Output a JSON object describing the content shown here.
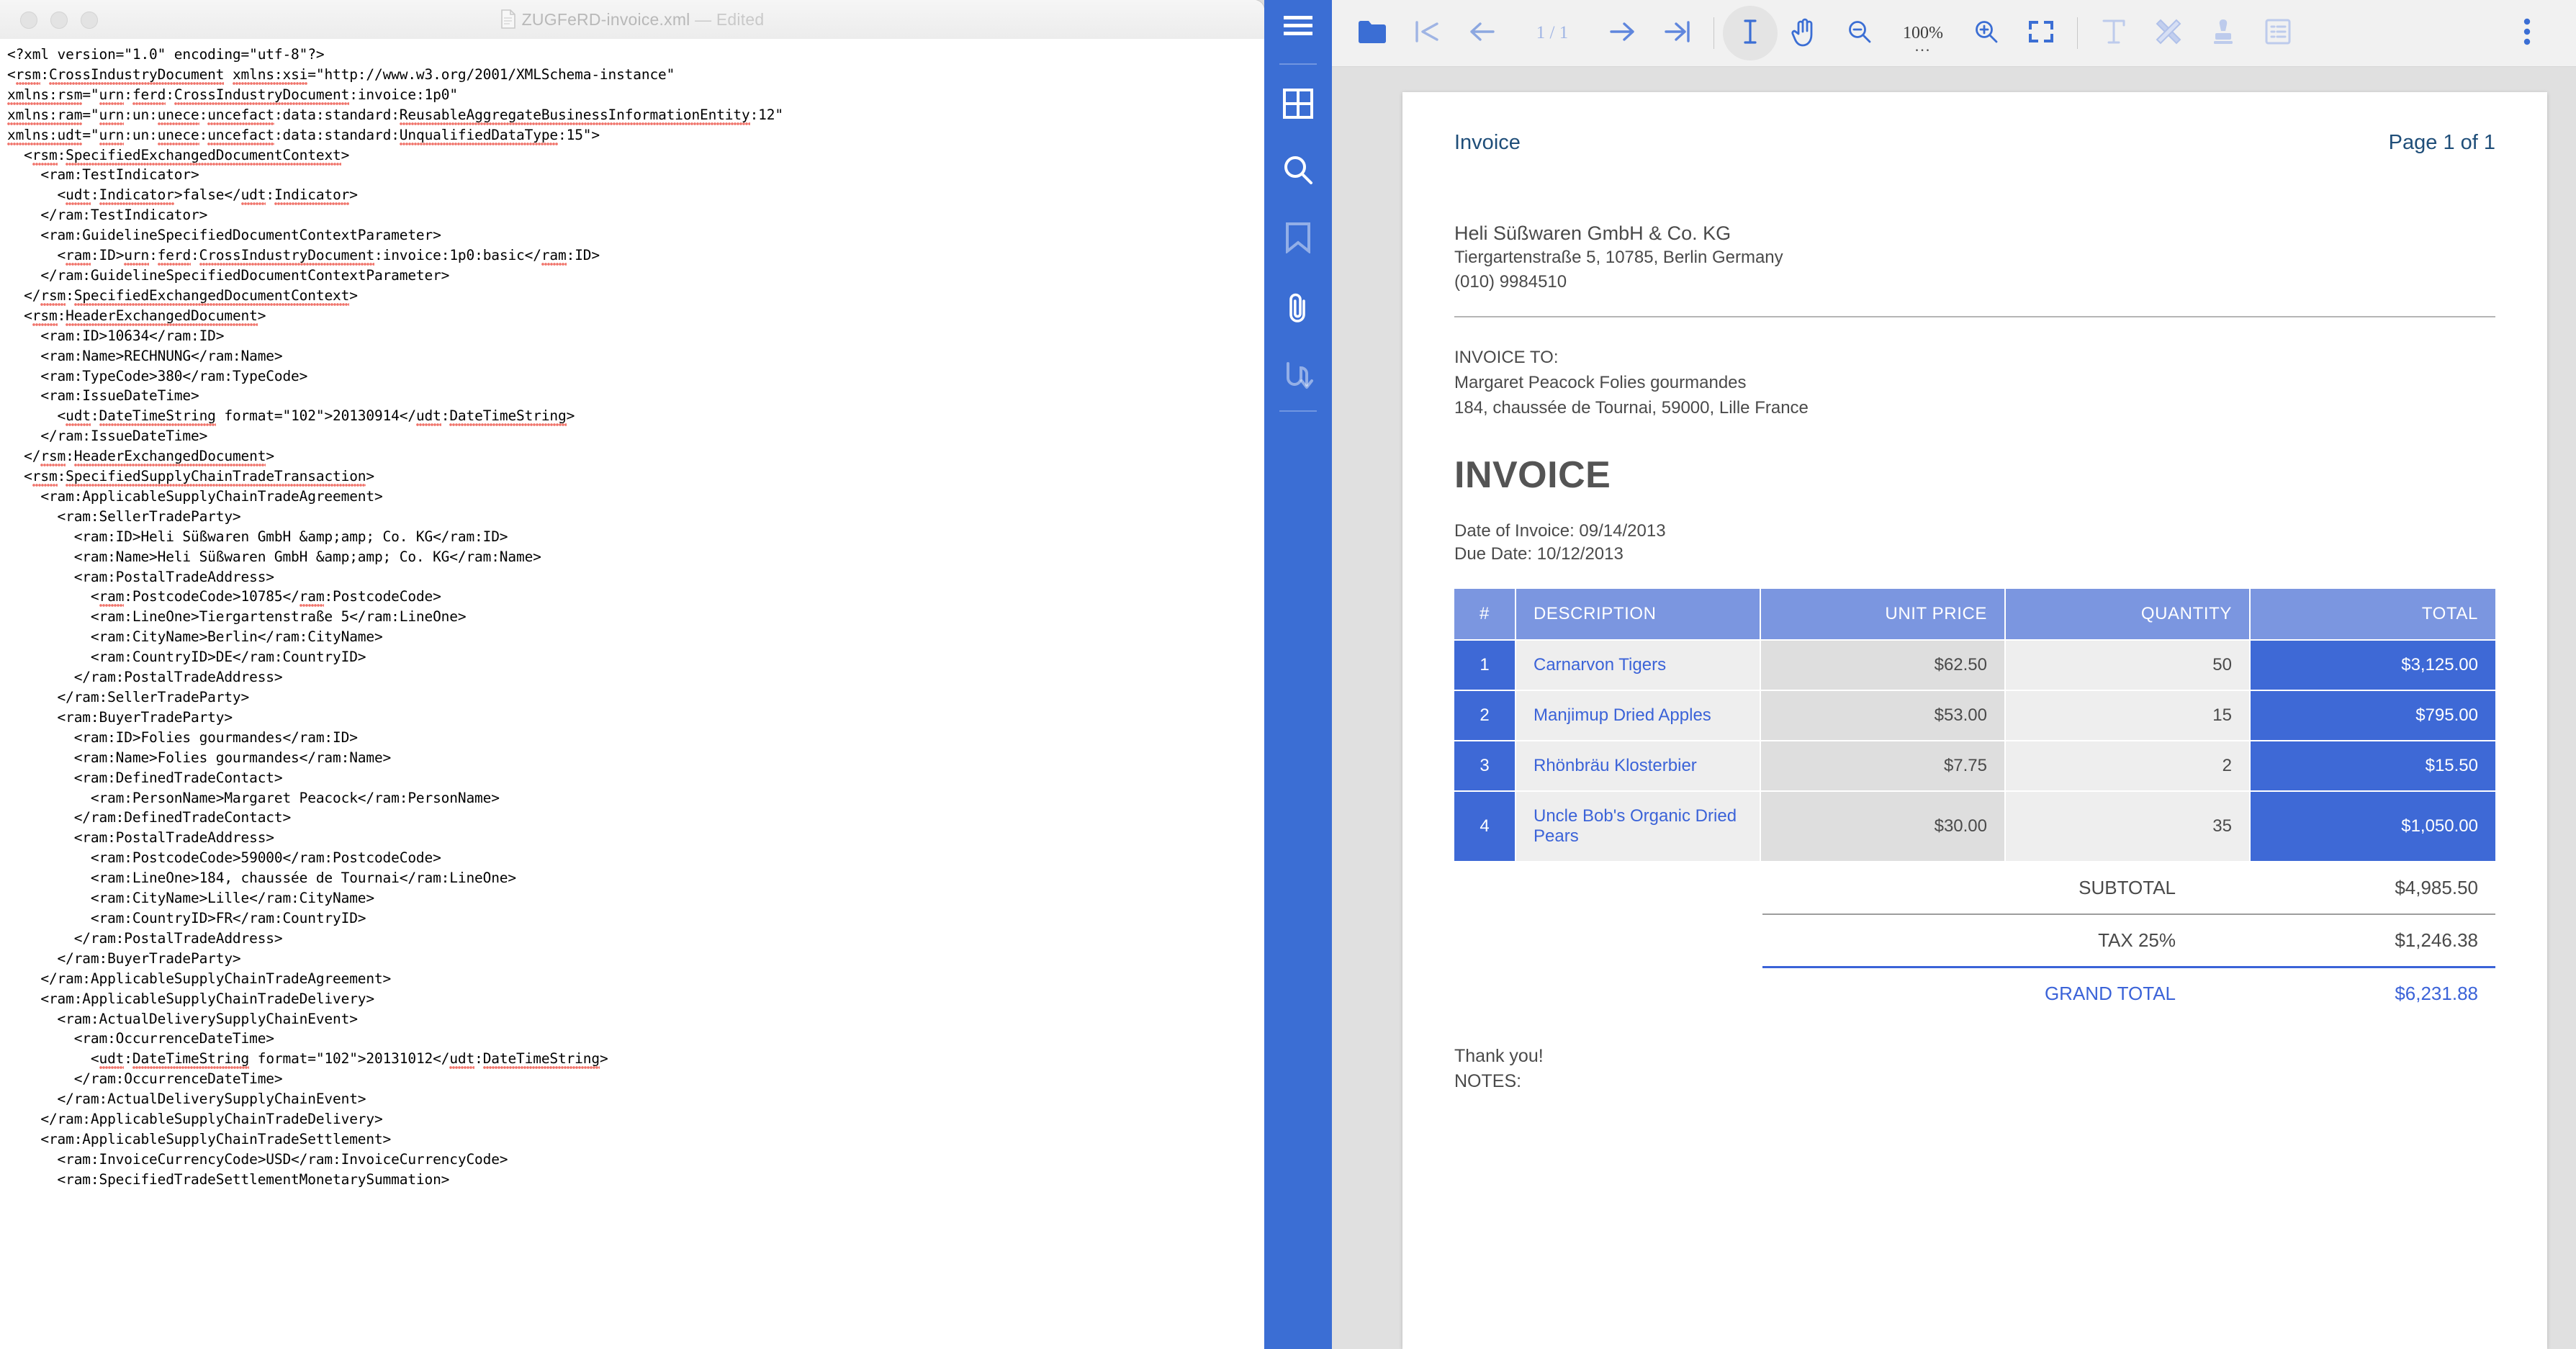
{
  "editor": {
    "window_title": "ZUGFeRD-invoice.xml",
    "title_separator": " — ",
    "edited_badge": "Edited",
    "xml_lines": [
      "<?xml version=\"1.0\" encoding=\"utf-8\"?>",
      "<rsm:CrossIndustryDocument xmlns:xsi=\"http://www.w3.org/2001/XMLSchema-instance\"",
      "xmlns:rsm=\"urn:ferd:CrossIndustryDocument:invoice:1p0\"",
      "xmlns:ram=\"urn:un:unece:uncefact:data:standard:ReusableAggregateBusinessInformationEntity:12\"",
      "xmlns:udt=\"urn:un:unece:uncefact:data:standard:UnqualifiedDataType:15\">",
      "  <rsm:SpecifiedExchangedDocumentContext>",
      "    <ram:TestIndicator>",
      "      <udt:Indicator>false</udt:Indicator>",
      "    </ram:TestIndicator>",
      "    <ram:GuidelineSpecifiedDocumentContextParameter>",
      "      <ram:ID>urn:ferd:CrossIndustryDocument:invoice:1p0:basic</ram:ID>",
      "    </ram:GuidelineSpecifiedDocumentContextParameter>",
      "  </rsm:SpecifiedExchangedDocumentContext>",
      "  <rsm:HeaderExchangedDocument>",
      "    <ram:ID>10634</ram:ID>",
      "    <ram:Name>RECHNUNG</ram:Name>",
      "    <ram:TypeCode>380</ram:TypeCode>",
      "    <ram:IssueDateTime>",
      "      <udt:DateTimeString format=\"102\">20130914</udt:DateTimeString>",
      "    </ram:IssueDateTime>",
      "  </rsm:HeaderExchangedDocument>",
      "  <rsm:SpecifiedSupplyChainTradeTransaction>",
      "    <ram:ApplicableSupplyChainTradeAgreement>",
      "      <ram:SellerTradeParty>",
      "        <ram:ID>Heli Süßwaren GmbH &amp;amp; Co. KG</ram:ID>",
      "        <ram:Name>Heli Süßwaren GmbH &amp;amp; Co. KG</ram:Name>",
      "        <ram:PostalTradeAddress>",
      "          <ram:PostcodeCode>10785</ram:PostcodeCode>",
      "          <ram:LineOne>Tiergartenstraße 5</ram:LineOne>",
      "          <ram:CityName>Berlin</ram:CityName>",
      "          <ram:CountryID>DE</ram:CountryID>",
      "        </ram:PostalTradeAddress>",
      "      </ram:SellerTradeParty>",
      "      <ram:BuyerTradeParty>",
      "        <ram:ID>Folies gourmandes</ram:ID>",
      "        <ram:Name>Folies gourmandes</ram:Name>",
      "        <ram:DefinedTradeContact>",
      "          <ram:PersonName>Margaret Peacock</ram:PersonName>",
      "        </ram:DefinedTradeContact>",
      "        <ram:PostalTradeAddress>",
      "          <ram:PostcodeCode>59000</ram:PostcodeCode>",
      "          <ram:LineOne>184, chaussée de Tournai</ram:LineOne>",
      "          <ram:CityName>Lille</ram:CityName>",
      "          <ram:CountryID>FR</ram:CountryID>",
      "        </ram:PostalTradeAddress>",
      "      </ram:BuyerTradeParty>",
      "    </ram:ApplicableSupplyChainTradeAgreement>",
      "    <ram:ApplicableSupplyChainTradeDelivery>",
      "      <ram:ActualDeliverySupplyChainEvent>",
      "        <ram:OccurrenceDateTime>",
      "          <udt:DateTimeString format=\"102\">20131012</udt:DateTimeString>",
      "        </ram:OccurrenceDateTime>",
      "      </ram:ActualDeliverySupplyChainEvent>",
      "    </ram:ApplicableSupplyChainTradeDelivery>",
      "    <ram:ApplicableSupplyChainTradeSettlement>",
      "      <ram:InvoiceCurrencyCode>USD</ram:InvoiceCurrencyCode>",
      "      <ram:SpecifiedTradeSettlementMonetarySummation>"
    ]
  },
  "pdf": {
    "rail": {
      "items": [
        {
          "name": "menu-icon",
          "label": "Menu"
        },
        {
          "name": "thumbnails-icon",
          "label": "Page Thumbnails"
        },
        {
          "name": "search-icon",
          "label": "Search"
        },
        {
          "name": "bookmark-icon",
          "label": "Bookmarks"
        },
        {
          "name": "attachment-icon",
          "label": "Attachments"
        },
        {
          "name": "signature-icon",
          "label": "Signatures"
        }
      ]
    },
    "toolbar": {
      "open_label": "Open",
      "first_page_label": "First Page",
      "previous_page_label": "Previous Page",
      "page_indicator": "1 / 1",
      "next_page_label": "Next Page",
      "last_page_label": "Last Page",
      "text_select_label": "Text Selection Tool",
      "pan_label": "Pan Tool",
      "zoom_out_label": "Zoom Out",
      "zoom_level": "100%",
      "zoom_dots": "...",
      "zoom_in_label": "Zoom In",
      "fit_label": "Fit Page",
      "text_tool_label": "Add Text",
      "highlight_label": "Highlight",
      "stamp_label": "Stamp",
      "form_label": "Forms",
      "more_label": "More Options"
    },
    "accent_color": "#3b6ed4"
  },
  "invoice": {
    "header_left": "Invoice",
    "header_right": "Page 1 of 1",
    "seller": {
      "name": "Heli Süßwaren GmbH & Co. KG",
      "address": "Tiergartenstraße 5, 10785, Berlin Germany",
      "phone": "(010) 9984510"
    },
    "buyer": {
      "label": "INVOICE TO:",
      "name": "Margaret Peacock Folies gourmandes",
      "address": "184, chaussée de Tournai, 59000, Lille France"
    },
    "title": "INVOICE",
    "date_of_invoice": "Date of Invoice: 09/14/2013",
    "due_date": "Due Date: 10/12/2013",
    "table": {
      "columns": [
        "#",
        "DESCRIPTION",
        "UNIT PRICE",
        "QUANTITY",
        "TOTAL"
      ],
      "rows": [
        {
          "idx": "1",
          "description": "Carnarvon Tigers",
          "unit_price": "$62.50",
          "quantity": "50",
          "total": "$3,125.00"
        },
        {
          "idx": "2",
          "description": "Manjimup Dried Apples",
          "unit_price": "$53.00",
          "quantity": "15",
          "total": "$795.00"
        },
        {
          "idx": "3",
          "description": "Rhönbräu Klosterbier",
          "unit_price": "$7.75",
          "quantity": "2",
          "total": "$15.50"
        },
        {
          "idx": "4",
          "description": "Uncle Bob's Organic Dried Pears",
          "unit_price": "$30.00",
          "quantity": "35",
          "total": "$1,050.00"
        }
      ]
    },
    "totals": [
      {
        "label": "SUBTOTAL",
        "value": "$4,985.50"
      },
      {
        "label": "TAX 25%",
        "value": "$1,246.38"
      },
      {
        "label": "GRAND TOTAL",
        "value": "$6,231.88"
      }
    ],
    "thank_you": "Thank you!",
    "notes_label": "NOTES:"
  }
}
